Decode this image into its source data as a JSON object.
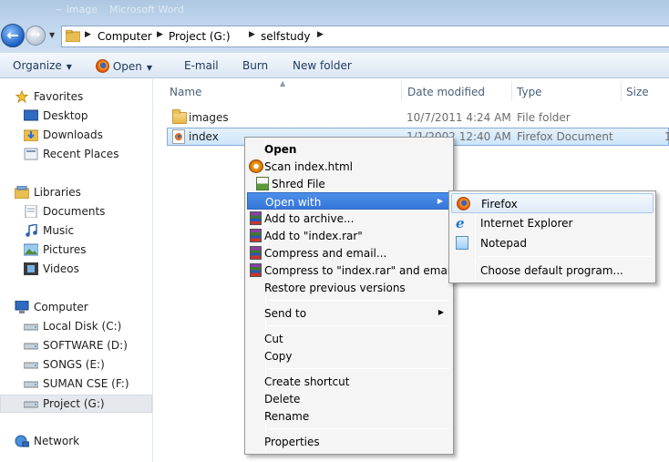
{
  "window": {
    "ghost_title_1": "~ image",
    "ghost_title_2": "Microsoft Word"
  },
  "address": {
    "crumbs": [
      "Computer",
      "Project (G:)",
      "selfstudy"
    ]
  },
  "toolbar": {
    "organize": "Organize",
    "open": "Open",
    "email": "E-mail",
    "burn": "Burn",
    "new_folder": "New folder"
  },
  "nav": {
    "favorites": "Favorites",
    "desktop": "Desktop",
    "downloads": "Downloads",
    "recent_places": "Recent Places",
    "libraries": "Libraries",
    "documents": "Documents",
    "music": "Music",
    "pictures": "Pictures",
    "videos": "Videos",
    "computer": "Computer",
    "local_disk": "Local Disk (C:)",
    "software": "SOFTWARE (D:)",
    "songs": "SONGS (E:)",
    "suman": "SUMAN CSE (F:)",
    "project": "Project (G:)",
    "network": "Network"
  },
  "columns": {
    "name": "Name",
    "date": "Date modified",
    "type": "Type",
    "size": "Size"
  },
  "files": [
    {
      "name": "images",
      "date": "10/7/2011 4:24 AM",
      "type": "File folder",
      "size": ""
    },
    {
      "name": "index",
      "date": "1/1/2002 12:40 AM",
      "type": "Firefox Document",
      "size": "1"
    }
  ],
  "context_menu": {
    "open": "Open",
    "scan": "Scan index.html",
    "shred": "Shred File",
    "open_with": "Open with",
    "add_archive": "Add to archive...",
    "add_rar": "Add to \"index.rar\"",
    "compress_email": "Compress and email...",
    "compress_rar_email": "Compress to \"index.rar\" and email",
    "restore": "Restore previous versions",
    "send_to": "Send to",
    "cut": "Cut",
    "copy": "Copy",
    "create_shortcut": "Create shortcut",
    "delete": "Delete",
    "rename": "Rename",
    "properties": "Properties"
  },
  "open_with_menu": {
    "firefox": "Firefox",
    "ie": "Internet Explorer",
    "notepad": "Notepad",
    "choose_default": "Choose default program..."
  }
}
